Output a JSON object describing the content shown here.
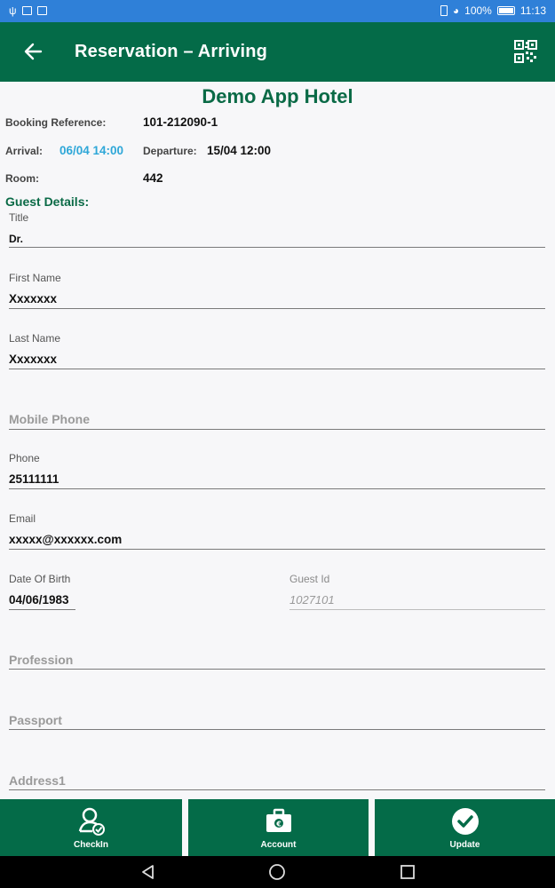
{
  "status_bar": {
    "battery": "100%",
    "time": "11:13",
    "icons": [
      "usb-icon",
      "image-icon",
      "mail-icon",
      "vibrate-icon",
      "wifi-icon",
      "battery-icon"
    ]
  },
  "app_bar": {
    "title": "Reservation – Arriving",
    "back_icon": "back-arrow-icon",
    "qr_icon": "qr-code-icon",
    "background": "#046b48"
  },
  "hotel_name": "Demo App Hotel",
  "booking": {
    "reference_label": "Booking Reference:",
    "reference_value": "101-212090-1",
    "arrival_label": "Arrival:",
    "arrival_value": "06/04 14:00",
    "departure_label": "Departure:",
    "departure_value": "15/04 12:00",
    "room_label": "Room:",
    "room_value": "442"
  },
  "guest_details": {
    "section_title": "Guest Details:",
    "title": {
      "label": "Title",
      "value": "Dr."
    },
    "first_name": {
      "label": "First Name",
      "value": "Xxxxxxx"
    },
    "last_name": {
      "label": "Last Name",
      "value": "Xxxxxxx"
    },
    "mobile_phone": {
      "placeholder": "Mobile Phone"
    },
    "phone": {
      "label": "Phone",
      "value": "25111111"
    },
    "email": {
      "label": "Email",
      "value": "xxxxx@xxxxxx.com"
    },
    "date_of_birth": {
      "label": "Date Of Birth",
      "value": "04/06/1983"
    },
    "guest_id": {
      "label": "Guest Id",
      "value": "1027101"
    },
    "profession": {
      "placeholder": "Profession"
    },
    "passport": {
      "placeholder": "Passport"
    },
    "address1": {
      "placeholder": "Address1"
    }
  },
  "actions": [
    {
      "label": "CheckIn",
      "icon": "checkin-person-icon"
    },
    {
      "label": "Account",
      "icon": "briefcase-euro-icon"
    },
    {
      "label": "Update",
      "icon": "check-circle-icon"
    }
  ],
  "colors": {
    "brand_green": "#046b48",
    "accent_blue": "#2ea7d8",
    "status_bar": "#2f80d8"
  }
}
